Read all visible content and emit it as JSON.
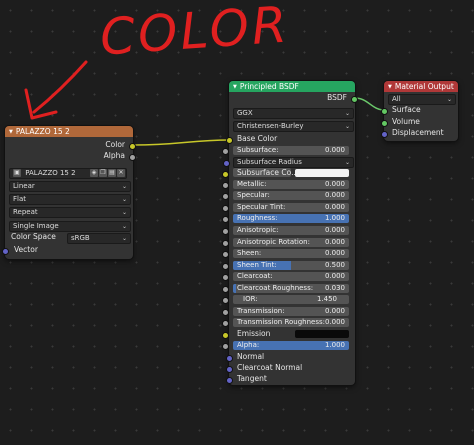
{
  "annotation": {
    "text": "COLOR"
  },
  "image_texture": {
    "title": "PALAZZO 15 2",
    "header_color": "#b0683a",
    "outputs": [
      "Color",
      "Alpha"
    ],
    "image_name": "PALAZZO 15 2",
    "interpolation": "Linear",
    "projection": "Flat",
    "extension": "Repeat",
    "source": "Single Image",
    "color_space_label": "Color Space",
    "color_space": "sRGB",
    "input_vector": "Vector"
  },
  "principled": {
    "title": "Principled BSDF",
    "header_color": "#26a560",
    "output": "BSDF",
    "distribution": "GGX",
    "subsurface_method": "Christensen-Burley",
    "base_color": "Base Color",
    "fields": [
      {
        "label": "Subsurface:",
        "value": "0.000"
      },
      {
        "label": "Subsurface Radius",
        "value": ""
      },
      {
        "label": "Subsurface Co..",
        "value": ""
      },
      {
        "label": "Metallic:",
        "value": "0.000"
      },
      {
        "label": "Specular:",
        "value": "0.000"
      },
      {
        "label": "Specular Tint:",
        "value": "0.000"
      },
      {
        "label": "Roughness:",
        "value": "1.000"
      },
      {
        "label": "Anisotropic:",
        "value": "0.000"
      },
      {
        "label": "Anisotropic Rotation:",
        "value": "0.000"
      },
      {
        "label": "Sheen:",
        "value": "0.000"
      },
      {
        "label": "Sheen Tint:",
        "value": "0.500"
      },
      {
        "label": "Clearcoat:",
        "value": "0.000"
      },
      {
        "label": "Clearcoat Roughness:",
        "value": "0.030"
      },
      {
        "label": "IOR:",
        "value": "1.450"
      },
      {
        "label": "Transmission:",
        "value": "0.000"
      },
      {
        "label": "Transmission Roughness:",
        "value": "0.000"
      },
      {
        "label": "Emission",
        "value": ""
      },
      {
        "label": "Alpha:",
        "value": "1.000"
      }
    ],
    "inputs_tail": [
      "Normal",
      "Clearcoat Normal",
      "Tangent"
    ]
  },
  "material_output": {
    "title": "Material Output",
    "header_color": "#b03838",
    "target": "All",
    "inputs": [
      "Surface",
      "Volume",
      "Displacement"
    ]
  }
}
